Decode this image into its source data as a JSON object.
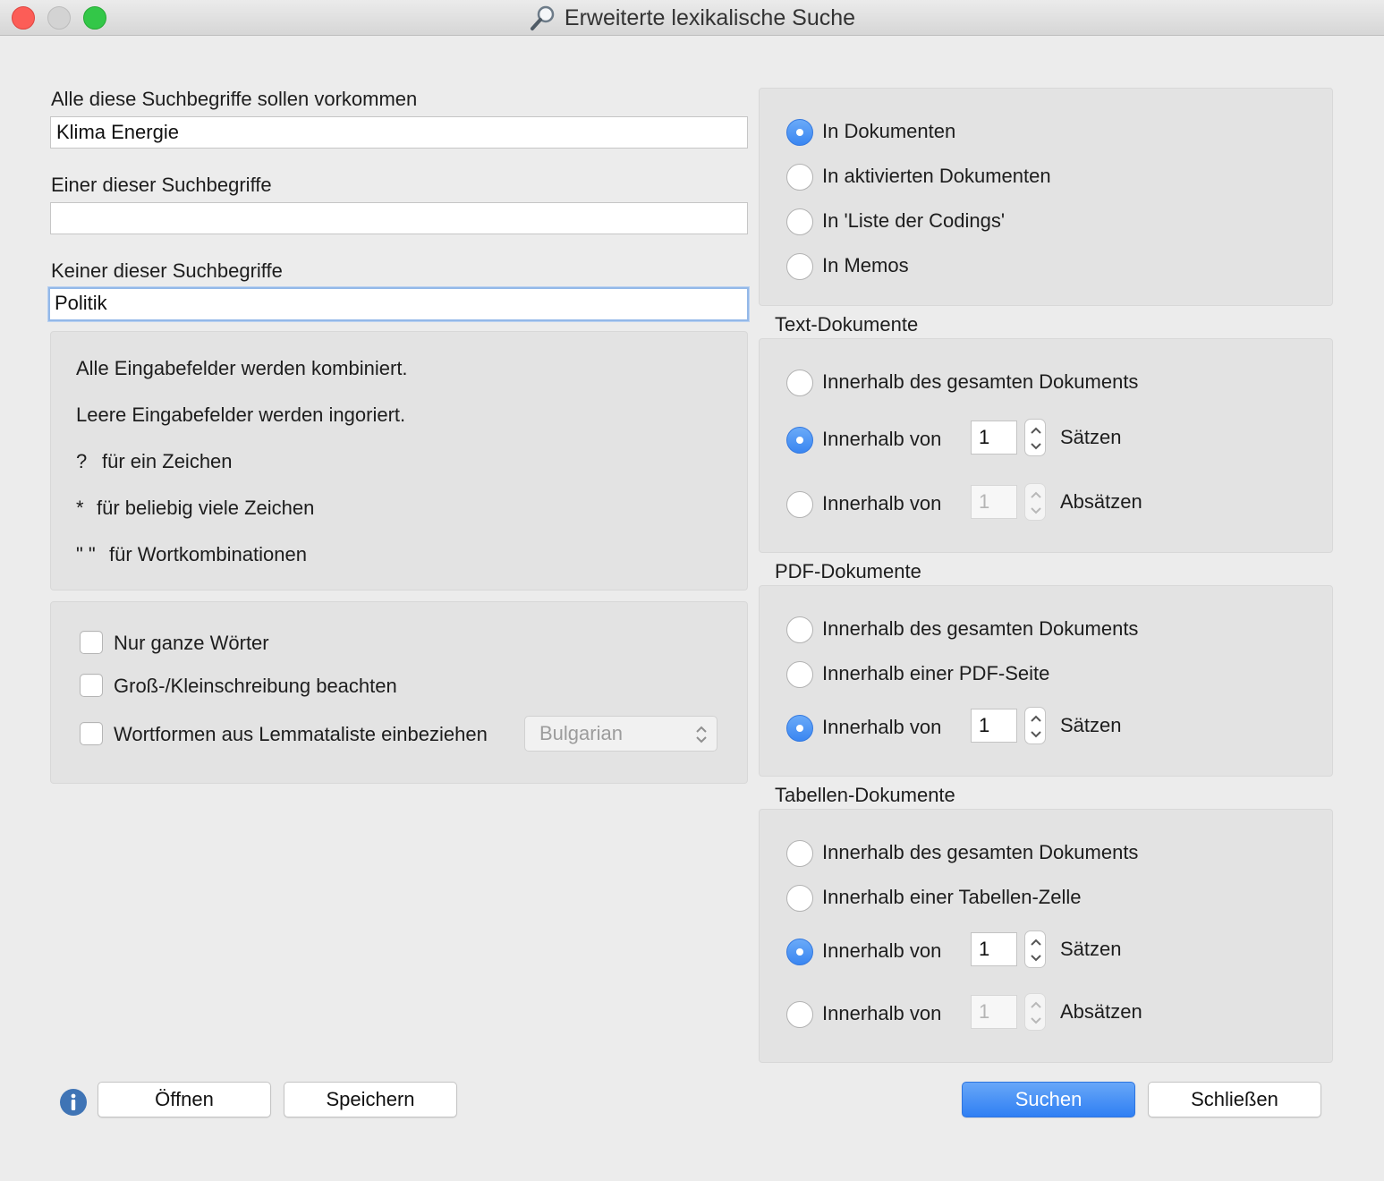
{
  "window": {
    "title": "Erweiterte lexikalische Suche",
    "title_icon": "magnifier-icon"
  },
  "search_terms": {
    "all_label": "Alle diese Suchbegriffe sollen vorkommen",
    "all_value": "Klima Energie",
    "any_label": "Einer dieser Suchbegriffe",
    "any_value": "",
    "none_label": "Keiner dieser Suchbegriffe",
    "none_value": "Politik"
  },
  "hints": {
    "line1": "Alle Eingabefelder werden kombiniert.",
    "line2": "Leere Eingabefelder werden ingoriert.",
    "q_symbol": "?",
    "q_text": "für ein Zeichen",
    "star_symbol": "*",
    "star_text": "für beliebig viele Zeichen",
    "quote_symbol": "\" \"",
    "quote_text": "für Wortkombinationen"
  },
  "options": {
    "whole_words": {
      "label": "Nur ganze Wörter",
      "checked": false
    },
    "case_sensitive": {
      "label": "Groß-/Kleinschreibung beachten",
      "checked": false
    },
    "lemma": {
      "label": "Wortformen aus Lemmataliste einbeziehen",
      "checked": false
    },
    "language_selected": "Bulgarian"
  },
  "scope": {
    "in_documents": "In Dokumenten",
    "in_activated": "In aktivierten Dokumenten",
    "in_codings": "In 'Liste der Codings'",
    "in_memos": "In Memos",
    "selected": "in_documents"
  },
  "text_docs": {
    "heading": "Text-Dokumente",
    "whole": "Innerhalb des gesamten Dokuments",
    "within_sentences_label": "Innerhalb von",
    "sentences_value": "1",
    "sentences_unit": "Sätzen",
    "within_paragraphs_label": "Innerhalb von",
    "paragraphs_value": "1",
    "paragraphs_unit": "Absätzen",
    "selected": "sentences"
  },
  "pdf_docs": {
    "heading": "PDF-Dokumente",
    "whole": "Innerhalb des gesamten Dokuments",
    "page": "Innerhalb einer PDF-Seite",
    "within_sentences_label": "Innerhalb von",
    "sentences_value": "1",
    "sentences_unit": "Sätzen",
    "selected": "sentences"
  },
  "table_docs": {
    "heading": "Tabellen-Dokumente",
    "whole": "Innerhalb des gesamten Dokuments",
    "cell": "Innerhalb einer Tabellen-Zelle",
    "within_sentences_label": "Innerhalb von",
    "sentences_value": "1",
    "sentences_unit": "Sätzen",
    "within_paragraphs_label": "Innerhalb von",
    "paragraphs_value": "1",
    "paragraphs_unit": "Absätzen",
    "selected": "sentences"
  },
  "buttons": {
    "open": "Öffnen",
    "save": "Speichern",
    "search": "Suchen",
    "close": "Schließen"
  },
  "colors": {
    "accent": "#3a86f1",
    "close_light": "#fc5d57",
    "minimize_light": "#d3d3d3",
    "zoom_light": "#33c748"
  }
}
